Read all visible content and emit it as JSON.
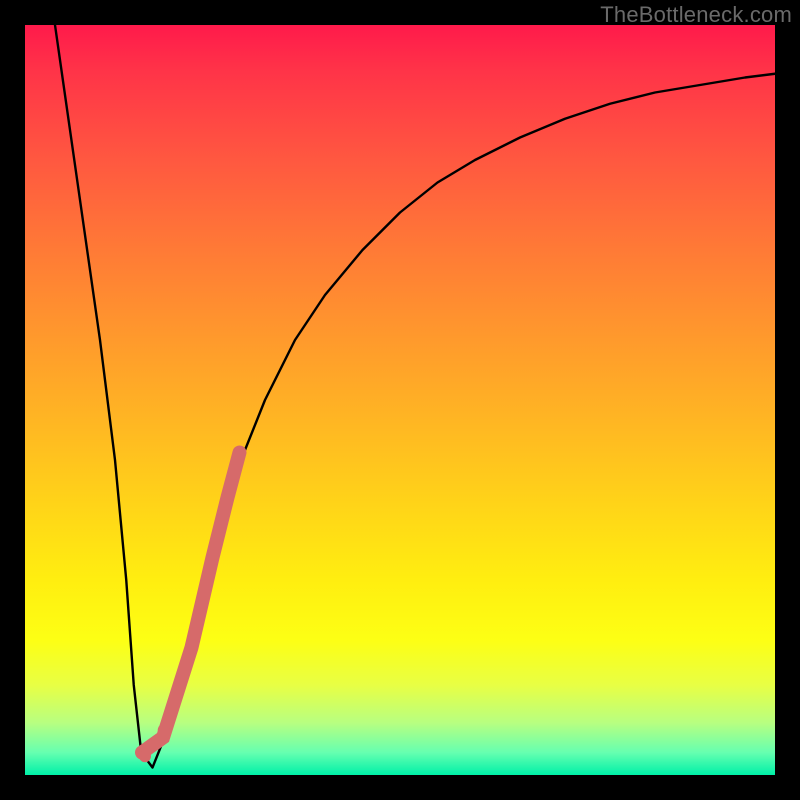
{
  "watermark": "TheBottleneck.com",
  "chart_data": {
    "type": "line",
    "title": "",
    "xlabel": "",
    "ylabel": "",
    "xlim": [
      0,
      100
    ],
    "ylim": [
      0,
      100
    ],
    "grid": false,
    "legend": false,
    "series": [
      {
        "name": "bottleneck-curve",
        "color": "#000000",
        "x": [
          4,
          6,
          8,
          10,
          12,
          13.5,
          14.5,
          15.5,
          17,
          19,
          22,
          25,
          28,
          32,
          36,
          40,
          45,
          50,
          55,
          60,
          66,
          72,
          78,
          84,
          90,
          96,
          100
        ],
        "y": [
          100,
          86,
          72,
          58,
          42,
          26,
          12,
          3,
          1,
          6,
          18,
          30,
          40,
          50,
          58,
          64,
          70,
          75,
          79,
          82,
          85,
          87.5,
          89.5,
          91,
          92,
          93,
          93.5
        ]
      }
    ],
    "highlight_segment": {
      "name": "highlighted-range",
      "color": "#d66a6a",
      "x": [
        15.6,
        18.4,
        22.2,
        25.0,
        27.0,
        28.6
      ],
      "y": [
        3,
        5,
        17,
        29,
        37,
        43
      ]
    },
    "highlight_dots": {
      "name": "highlight-dots",
      "color": "#d66a6a",
      "points": [
        {
          "x": 16.0,
          "y": 2.5
        },
        {
          "x": 17.2,
          "y": 4.0
        },
        {
          "x": 18.5,
          "y": 6.0
        }
      ]
    }
  }
}
